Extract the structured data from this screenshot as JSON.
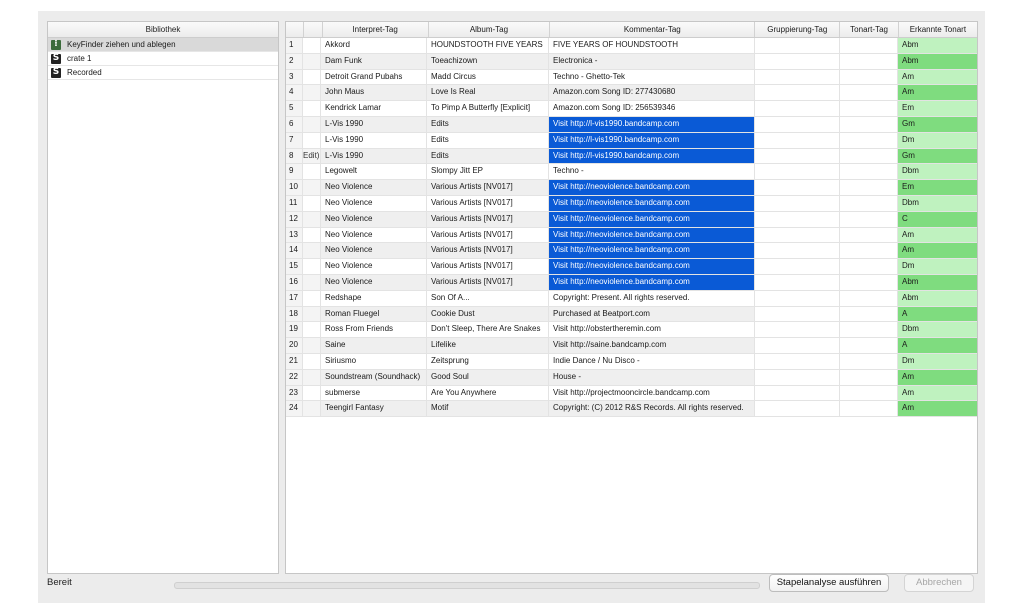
{
  "library": {
    "header": "Bibliothek",
    "items": [
      {
        "label": "KeyFinder ziehen und ablegen",
        "icon": "keyfinder-icon",
        "selected": true
      },
      {
        "label": "crate 1",
        "icon": "serato-icon",
        "selected": false
      },
      {
        "label": "Recorded",
        "icon": "serato-icon",
        "selected": false
      }
    ]
  },
  "table": {
    "headers": [
      "",
      "",
      "Interpret-Tag",
      "Album-Tag",
      "Kommentar-Tag",
      "Gruppierung-Tag",
      "Tonart-Tag",
      "Erkannte Tonart"
    ],
    "rows": [
      {
        "num": "1",
        "file": "",
        "artist": "Akkord",
        "album": "HOUNDSTOOTH FIVE YEARS",
        "comment": "FIVE YEARS OF HOUNDSTOOTH",
        "grouping": "",
        "key_tag": "",
        "detected": "Abm",
        "highlight": false
      },
      {
        "num": "2",
        "file": "",
        "artist": "Dam Funk",
        "album": "Toeachizown",
        "comment": "Electronica -",
        "grouping": "",
        "key_tag": "",
        "detected": "Abm",
        "highlight": false
      },
      {
        "num": "3",
        "file": "",
        "artist": "Detroit Grand Pubahs",
        "album": "Madd Circus",
        "comment": "Techno - Ghetto-Tek",
        "grouping": "",
        "key_tag": "",
        "detected": "Am",
        "highlight": false
      },
      {
        "num": "4",
        "file": "",
        "artist": "John Maus",
        "album": "Love Is Real",
        "comment": "Amazon.com Song ID: 277430680",
        "grouping": "",
        "key_tag": "",
        "detected": "Am",
        "highlight": false
      },
      {
        "num": "5",
        "file": "",
        "artist": "Kendrick Lamar",
        "album": "To Pimp A Butterfly [Explicit]",
        "comment": "Amazon.com Song ID: 256539346",
        "grouping": "",
        "key_tag": "",
        "detected": "Em",
        "highlight": false
      },
      {
        "num": "6",
        "file": "",
        "artist": "L-Vis 1990",
        "album": "Edits",
        "comment": "Visit http://l-vis1990.bandcamp.com",
        "grouping": "",
        "key_tag": "",
        "detected": "Gm",
        "highlight": true
      },
      {
        "num": "7",
        "file": "",
        "artist": "L-Vis 1990",
        "album": "Edits",
        "comment": "Visit http://l-vis1990.bandcamp.com",
        "grouping": "",
        "key_tag": "",
        "detected": "Dm",
        "highlight": true
      },
      {
        "num": "8",
        "file": "Edit)",
        "artist": "L-Vis 1990",
        "album": "Edits",
        "comment": "Visit http://l-vis1990.bandcamp.com",
        "grouping": "",
        "key_tag": "",
        "detected": "Gm",
        "highlight": true
      },
      {
        "num": "9",
        "file": "",
        "artist": "Legowelt",
        "album": "Slompy Jitt EP",
        "comment": "Techno -",
        "grouping": "",
        "key_tag": "",
        "detected": "Dbm",
        "highlight": false
      },
      {
        "num": "10",
        "file": "",
        "artist": "Neo Violence",
        "album": "Various Artists [NV017]",
        "comment": "Visit http://neoviolence.bandcamp.com",
        "grouping": "",
        "key_tag": "",
        "detected": "Em",
        "highlight": true
      },
      {
        "num": "11",
        "file": "",
        "artist": "Neo Violence",
        "album": "Various Artists [NV017]",
        "comment": "Visit http://neoviolence.bandcamp.com",
        "grouping": "",
        "key_tag": "",
        "detected": "Dbm",
        "highlight": true
      },
      {
        "num": "12",
        "file": "",
        "artist": "Neo Violence",
        "album": "Various Artists [NV017]",
        "comment": "Visit http://neoviolence.bandcamp.com",
        "grouping": "",
        "key_tag": "",
        "detected": "C",
        "highlight": true
      },
      {
        "num": "13",
        "file": "",
        "artist": "Neo Violence",
        "album": "Various Artists [NV017]",
        "comment": "Visit http://neoviolence.bandcamp.com",
        "grouping": "",
        "key_tag": "",
        "detected": "Am",
        "highlight": true
      },
      {
        "num": "14",
        "file": "",
        "artist": "Neo Violence",
        "album": "Various Artists [NV017]",
        "comment": "Visit http://neoviolence.bandcamp.com",
        "grouping": "",
        "key_tag": "",
        "detected": "Am",
        "highlight": true
      },
      {
        "num": "15",
        "file": "",
        "artist": "Neo Violence",
        "album": "Various Artists [NV017]",
        "comment": "Visit http://neoviolence.bandcamp.com",
        "grouping": "",
        "key_tag": "",
        "detected": "Dm",
        "highlight": true
      },
      {
        "num": "16",
        "file": "",
        "artist": "Neo Violence",
        "album": "Various Artists [NV017]",
        "comment": "Visit http://neoviolence.bandcamp.com",
        "grouping": "",
        "key_tag": "",
        "detected": "Abm",
        "highlight": true
      },
      {
        "num": "17",
        "file": "",
        "artist": "Redshape",
        "album": "Son Of A...",
        "comment": "Copyright: Present. All rights reserved.",
        "grouping": "",
        "key_tag": "",
        "detected": "Abm",
        "highlight": false
      },
      {
        "num": "18",
        "file": "",
        "artist": "Roman Fluegel",
        "album": "Cookie Dust",
        "comment": "Purchased at Beatport.com",
        "grouping": "",
        "key_tag": "",
        "detected": "A",
        "highlight": false
      },
      {
        "num": "19",
        "file": "",
        "artist": "Ross From Friends",
        "album": "Don't Sleep, There Are Snakes",
        "comment": "Visit http://obstertheremin.com",
        "grouping": "",
        "key_tag": "",
        "detected": "Dbm",
        "highlight": false
      },
      {
        "num": "20",
        "file": "",
        "artist": "Saine",
        "album": "Lifelike",
        "comment": "Visit http://saine.bandcamp.com",
        "grouping": "",
        "key_tag": "",
        "detected": "A",
        "highlight": false
      },
      {
        "num": "21",
        "file": "",
        "artist": "Siriusmo",
        "album": "Zeitsprung",
        "comment": "Indie Dance / Nu Disco -",
        "grouping": "",
        "key_tag": "",
        "detected": "Dm",
        "highlight": false
      },
      {
        "num": "22",
        "file": "",
        "artist": "Soundstream (Soundhack)",
        "album": "Good Soul",
        "comment": "House -",
        "grouping": "",
        "key_tag": "",
        "detected": "Am",
        "highlight": false
      },
      {
        "num": "23",
        "file": "",
        "artist": "submerse",
        "album": "Are You Anywhere",
        "comment": "Visit http://projectmooncircle.bandcamp.com",
        "grouping": "",
        "key_tag": "",
        "detected": "Am",
        "highlight": false
      },
      {
        "num": "24",
        "file": "",
        "artist": "Teengirl Fantasy",
        "album": "Motif",
        "comment": "Copyright: (C) 2012 R&S Records. All rights reserved.",
        "grouping": "",
        "key_tag": "",
        "detected": "Am",
        "highlight": false
      }
    ]
  },
  "footer": {
    "status": "Bereit",
    "progress": 0,
    "run_button": "Stapelanalyse ausführen",
    "cancel_button": "Abbrechen"
  },
  "colors": {
    "highlight": "#0a5ad6",
    "key_dark": "#7fdc7f",
    "key_light": "#bff2bf"
  }
}
